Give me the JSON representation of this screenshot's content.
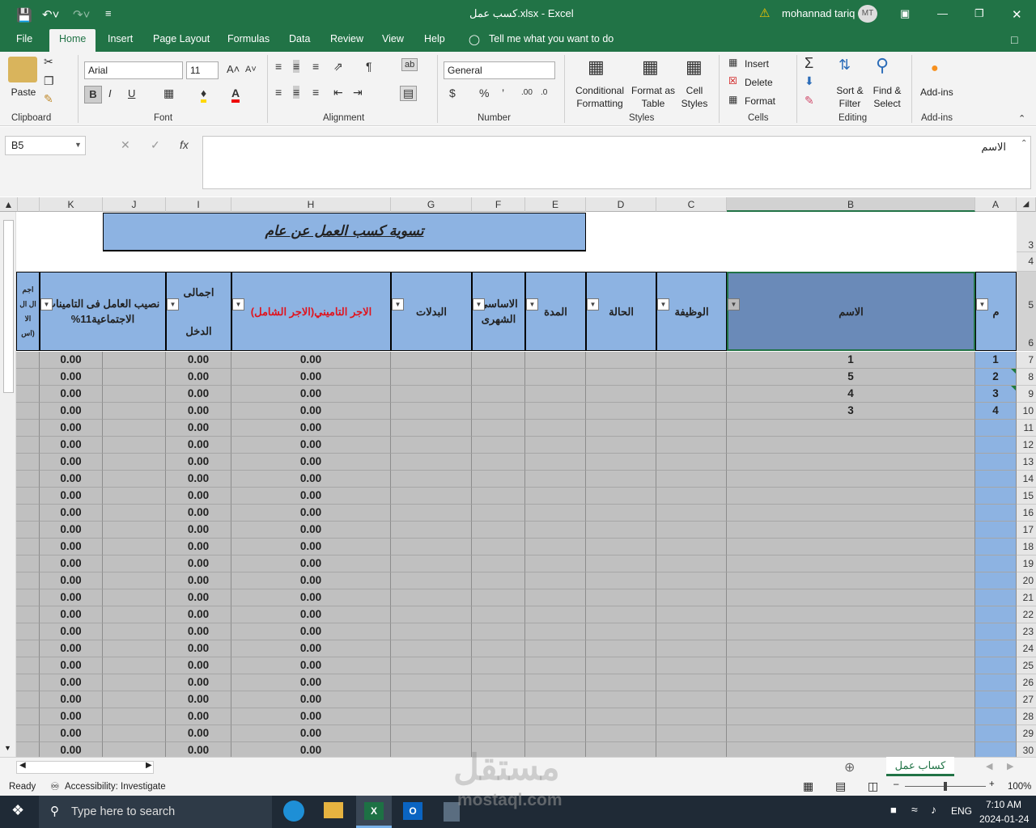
{
  "window": {
    "title": "كسب عمل.xlsx  -  Excel",
    "user": "mohannad tariq",
    "avatar": "MT"
  },
  "menu": [
    "File",
    "Home",
    "Insert",
    "Page Layout",
    "Formulas",
    "Data",
    "Review",
    "View",
    "Help"
  ],
  "tell_me": "Tell me what you want to do",
  "ribbon": {
    "clipboard": {
      "paste": "Paste",
      "label": "Clipboard"
    },
    "font": {
      "name": "Arial",
      "size": "11",
      "label": "Font"
    },
    "alignment": {
      "label": "Alignment"
    },
    "number": {
      "format": "General",
      "label": "Number"
    },
    "styles": {
      "conditional": "Conditional",
      "conditional2": "Formatting",
      "format_table": "Format as",
      "format_table2": "Table",
      "cell_styles": "Cell",
      "cell_styles2": "Styles",
      "label": "Styles"
    },
    "cells": {
      "insert": "Insert",
      "delete": "Delete",
      "format": "Format",
      "label": "Cells"
    },
    "editing": {
      "sort": "Sort &",
      "sort2": "Filter",
      "find": "Find &",
      "find2": "Select",
      "label": "Editing"
    },
    "addins": {
      "btn": "Add-ins",
      "label": "Add-ins"
    }
  },
  "formula_bar": {
    "name_box": "B5",
    "content": "الاسم"
  },
  "columns": [
    "K",
    "J",
    "I",
    "H",
    "G",
    "F",
    "E",
    "D",
    "C",
    "B",
    "A"
  ],
  "rows": [
    "3",
    "4",
    "5",
    "6",
    "7",
    "8",
    "9",
    "10",
    "11",
    "12",
    "13",
    "14",
    "15",
    "16",
    "17",
    "18",
    "19",
    "20",
    "21",
    "22",
    "23",
    "24",
    "25",
    "26",
    "27",
    "28",
    "29",
    "30"
  ],
  "sheet": {
    "title": "تسوية كسب العمل عن عام",
    "headers": {
      "m": "م",
      "name": "الاسم",
      "job": "الوظيفة",
      "status": "الحالة",
      "duration": "المدة",
      "basic": "الاساسى الشهرى",
      "allow": "البدلات",
      "insured": "الاجر التاميني(الاجر الشامل)",
      "total1": "اجمالى",
      "total2": "الدخل",
      "share1": "نصيب العامل فى التامينات",
      "share2": "الاجتماعية11%",
      "partial": "اجم ال ال الا (اس"
    },
    "ids": [
      "1",
      "2",
      "3",
      "4"
    ],
    "names": [
      "1",
      "5",
      "4",
      "3"
    ],
    "zero": "0.00"
  },
  "sheet_tab": "كساب عمل",
  "status": {
    "ready": "Ready",
    "accessibility": "Accessibility: Investigate",
    "zoom": "100%"
  },
  "taskbar": {
    "search": "Type here to search",
    "lang": "ENG",
    "time": "7:10 AM",
    "date": "2024-01-24"
  },
  "watermark": {
    "text": "mostaql.com",
    "logo": "مستقل"
  }
}
